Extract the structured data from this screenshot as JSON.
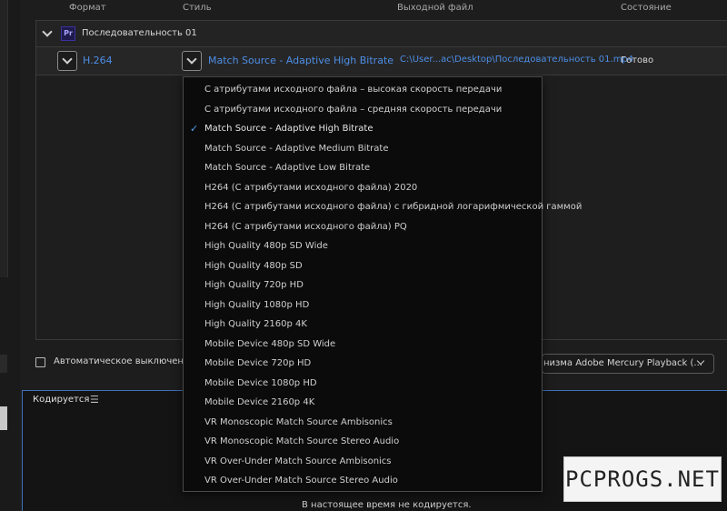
{
  "columns": {
    "format": "Формат",
    "style": "Стиль",
    "output": "Выходной файл",
    "status": "Состояние"
  },
  "sequence": {
    "app_badge": "Pr",
    "name": "Последовательность 01"
  },
  "item": {
    "format": "H.264",
    "style": "Match Source - Adaptive High Bitrate",
    "output": "C:\\User...ac\\Desktop\\Последовательность 01.mp4",
    "status": "Готово"
  },
  "preset_menu": {
    "selected_index": 2,
    "items": [
      "С атрибутами исходного файла – высокая скорость передачи",
      "С атрибутами исходного файла – средняя скорость передачи",
      "Match Source - Adaptive High Bitrate",
      "Match Source - Adaptive Medium Bitrate",
      "Match Source - Adaptive Low Bitrate",
      "H264 (С атрибутами исходного файла) 2020",
      "H264 (С атрибутами исходного файла) с гибридной логарифмической гаммой",
      "H264 (С атрибутами исходного файла) PQ",
      "High Quality 480p SD Wide",
      "High Quality 480p SD",
      "High Quality 720p HD",
      "High Quality 1080p HD",
      "High Quality 2160p 4K",
      "Mobile Device 480p SD Wide",
      "Mobile Device 720p HD",
      "Mobile Device 1080p HD",
      "Mobile Device 2160p 4K",
      "VR Monoscopic Match Source Ambisonics",
      "VR Monoscopic Match Source Stereo Audio",
      "VR Over-Under Match Source Ambisonics",
      "VR Over-Under Match Source Stereo Audio"
    ]
  },
  "auto_shutdown": {
    "label": "Автоматическое выключение",
    "checked": false
  },
  "renderer": {
    "value": "низма Adobe Mercury Playback (..."
  },
  "encoding_panel": {
    "title": "Кодируется",
    "menu_icon": "hamburger-icon",
    "status_message": "В настоящее время не кодируется."
  },
  "watermark": {
    "text": "PCPROGS.NET"
  },
  "colors": {
    "accent": "#4d8ee6",
    "check": "#5a9cf0",
    "panel_border": "#3f6fb8"
  }
}
